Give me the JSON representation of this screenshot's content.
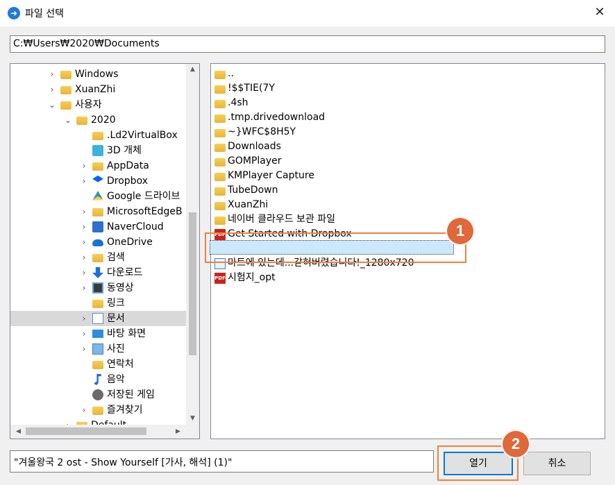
{
  "window": {
    "title": "파일 선택",
    "close_glyph": "✕",
    "app_icon": "arrow-icon"
  },
  "address": {
    "path": "C:₩Users₩2020₩Documents"
  },
  "tree": {
    "items": [
      {
        "label": "Windows",
        "expander": "collapsed",
        "icon": "folder-icon"
      },
      {
        "label": "XuanZhi",
        "expander": "collapsed",
        "icon": "folder-icon"
      },
      {
        "label": "사용자",
        "expander": "expanded",
        "icon": "folder-icon"
      },
      {
        "label": "2020",
        "expander": "expanded",
        "icon": "folder-icon"
      },
      {
        "label": ".Ld2VirtualBox",
        "expander": "none",
        "icon": "folder-icon"
      },
      {
        "label": "3D 개체",
        "expander": "none",
        "icon": "cube-icon"
      },
      {
        "label": "AppData",
        "expander": "collapsed",
        "icon": "folder-icon"
      },
      {
        "label": "Dropbox",
        "expander": "collapsed",
        "icon": "dropbox-icon"
      },
      {
        "label": "Google 드라이브",
        "expander": "none",
        "icon": "google-drive-icon"
      },
      {
        "label": "MicrosoftEdgeB",
        "expander": "collapsed",
        "icon": "folder-icon"
      },
      {
        "label": "NaverCloud",
        "expander": "collapsed",
        "icon": "naver-cloud-icon"
      },
      {
        "label": "OneDrive",
        "expander": "collapsed",
        "icon": "onedrive-icon"
      },
      {
        "label": "검색",
        "expander": "collapsed",
        "icon": "search-folder-icon"
      },
      {
        "label": "다운로드",
        "expander": "collapsed",
        "icon": "download-icon"
      },
      {
        "label": "동영상",
        "expander": "collapsed",
        "icon": "video-icon"
      },
      {
        "label": "링크",
        "expander": "none",
        "icon": "link-folder-icon"
      },
      {
        "label": "문서",
        "expander": "collapsed",
        "icon": "document-icon",
        "selected": true
      },
      {
        "label": "바탕 화면",
        "expander": "collapsed",
        "icon": "desktop-icon"
      },
      {
        "label": "사진",
        "expander": "collapsed",
        "icon": "pictures-icon"
      },
      {
        "label": "연락처",
        "expander": "none",
        "icon": "contacts-icon"
      },
      {
        "label": "음악",
        "expander": "none",
        "icon": "music-icon"
      },
      {
        "label": "저장된 게임",
        "expander": "none",
        "icon": "saved-games-icon"
      },
      {
        "label": "즐겨찾기",
        "expander": "collapsed",
        "icon": "favorites-icon"
      },
      {
        "label": "Default",
        "expander": "collapsed",
        "icon": "folder-icon"
      }
    ]
  },
  "files": {
    "items": [
      {
        "name": "..",
        "icon": "folder-icon"
      },
      {
        "name": "!$$TIE(7Y",
        "icon": "folder-icon"
      },
      {
        "name": ".4sh",
        "icon": "folder-icon"
      },
      {
        "name": ".tmp.drivedownload",
        "icon": "folder-icon"
      },
      {
        "name": "~}WFC$8H5Y",
        "icon": "folder-icon"
      },
      {
        "name": "Downloads",
        "icon": "folder-icon"
      },
      {
        "name": "GOMPlayer",
        "icon": "folder-icon"
      },
      {
        "name": "KMPlayer Capture",
        "icon": "folder-icon"
      },
      {
        "name": "TubeDown",
        "icon": "folder-icon"
      },
      {
        "name": "XuanZhi",
        "icon": "folder-icon"
      },
      {
        "name": "네이버 클라우드 보관 파일",
        "icon": "folder-icon"
      },
      {
        "name": "Get Started with Dropbox",
        "icon": "pdf-icon"
      },
      {
        "name": "겨울왕국 2 ost - Show Yourself [가사, 해석] (1)",
        "icon": "audio-file-icon",
        "selected": true
      },
      {
        "name": "마트에 있는데...갇혀버렸습니다!_1280x720",
        "icon": "image-file-icon"
      },
      {
        "name": "시험지_opt",
        "icon": "pdf-icon"
      }
    ]
  },
  "filename_field": {
    "value": "\"겨울왕국 2 ost - Show Yourself [가사, 해석] (1)\""
  },
  "buttons": {
    "open": "열기",
    "cancel": "취소"
  },
  "annotations": {
    "step1": "1",
    "step2": "2",
    "color": "#e0683a"
  },
  "pdf_glyph": "PDF"
}
